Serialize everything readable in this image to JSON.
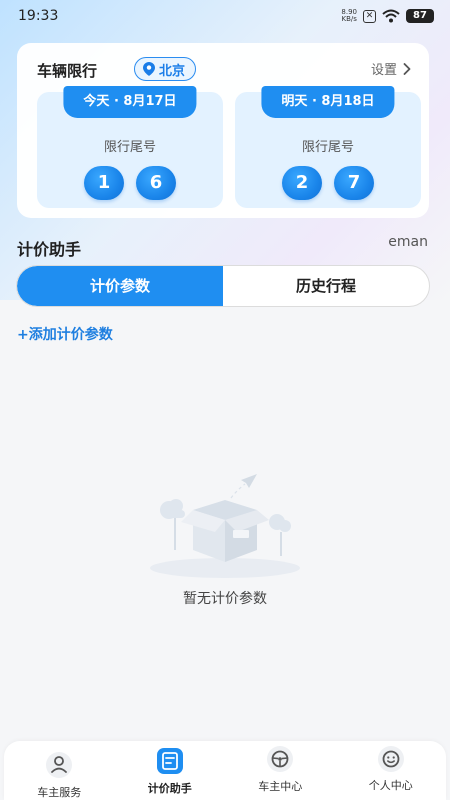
{
  "status": {
    "time": "19:33",
    "net_speed_value": "8.90",
    "net_speed_unit": "KB/s",
    "battery": "87"
  },
  "restriction": {
    "title": "车辆限行",
    "city": "北京",
    "settings": "设置",
    "days": [
      {
        "tab": "今天 · 8月17日",
        "label": "限行尾号",
        "digits": [
          "1",
          "6"
        ]
      },
      {
        "tab": "明天 · 8月18日",
        "label": "限行尾号",
        "digits": [
          "2",
          "7"
        ]
      }
    ]
  },
  "pricing": {
    "title": "计价助手",
    "extra": "eman",
    "tabs": [
      "计价参数",
      "历史行程"
    ],
    "add_link": "+添加计价参数",
    "empty_text": "暂无计价参数"
  },
  "tabbar": [
    {
      "label": "车主服务",
      "icon": "user-service-icon"
    },
    {
      "label": "计价助手",
      "icon": "calculator-icon"
    },
    {
      "label": "车主中心",
      "icon": "steering-wheel-icon"
    },
    {
      "label": "个人中心",
      "icon": "smiley-face-icon"
    }
  ],
  "colors": {
    "accent": "#1f8ef1",
    "accent_text": "#1f7fe0",
    "panel_bg": "#e3f2ff"
  }
}
